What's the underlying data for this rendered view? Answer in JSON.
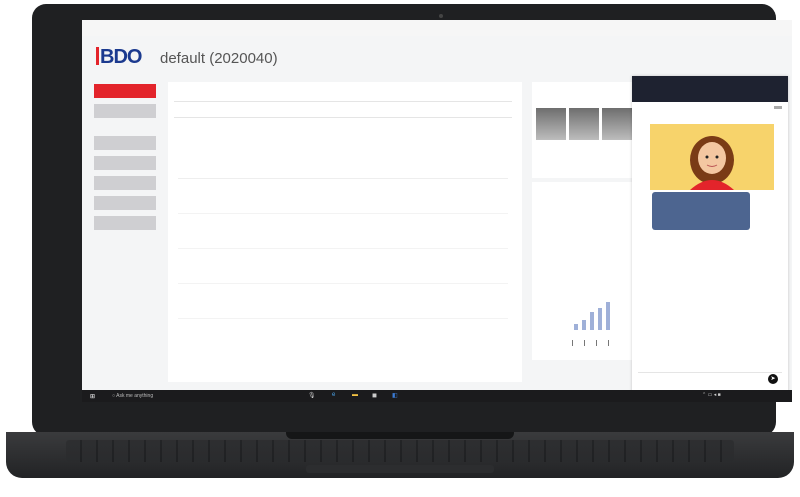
{
  "app": {
    "brand": "BDO",
    "page_title": "default (2020040)"
  },
  "taskbar": {
    "search_placeholder": "Ask me anything"
  }
}
